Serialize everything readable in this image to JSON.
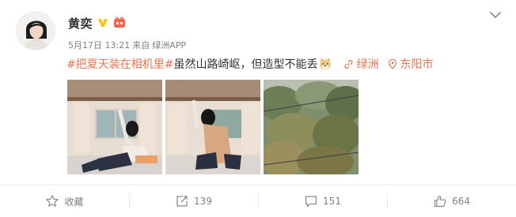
{
  "post": {
    "author": "黄奕",
    "verified_icon": "v-badge-icon",
    "member_icon": "member-badge-icon",
    "date": "5月17日 13:21",
    "source_prefix": "来自",
    "source": "绿洲APP",
    "topic": "#把夏天装在相机里#",
    "text": "虽然山路崎岖，但造型不能丢",
    "emoji": "doge-emoji-icon",
    "link_oasis": "绿洲",
    "location": "东阳市",
    "images": [
      "photo-1",
      "photo-2",
      "photo-3"
    ]
  },
  "actions": {
    "favorite": "收藏",
    "repost": "139",
    "comment": "151",
    "like": "664"
  },
  "colors": {
    "accent": "#eb7350",
    "muted": "#808080",
    "verified": "#ffc000"
  }
}
